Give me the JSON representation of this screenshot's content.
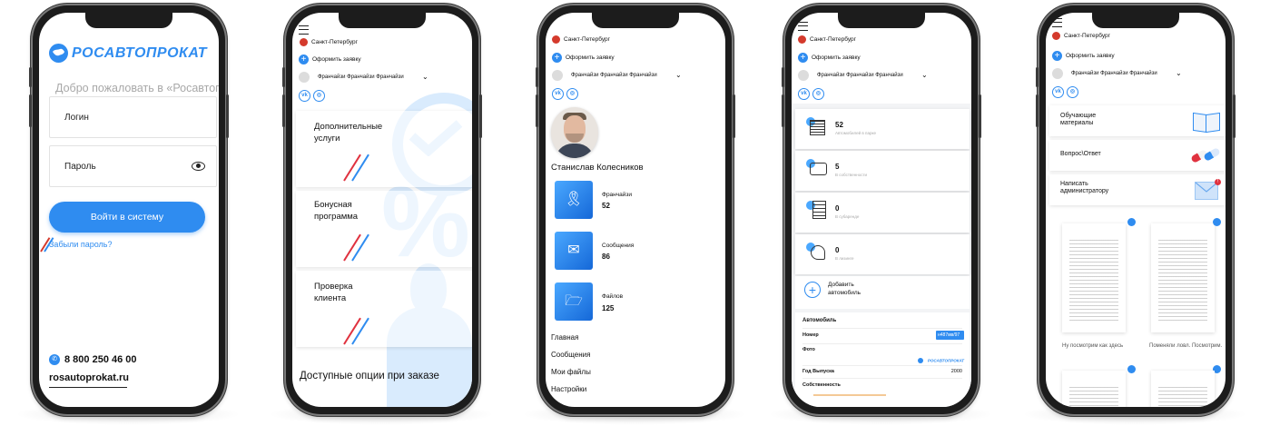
{
  "brand": {
    "logo_text": "РОСАВТОПРОКАТ",
    "accent": "#2f8cf0",
    "city_pin_color": "#d43a2c"
  },
  "login": {
    "welcome": "Добро пожаловать в «Росавтопрок",
    "login_placeholder": "Логин",
    "password_placeholder": "Пароль",
    "submit": "Войти в систему",
    "forgot": "Забыли пароль?",
    "phone": "8 800 250 46 00",
    "site": "rosautoprokat.ru"
  },
  "header": {
    "city": "Санкт-Петербург",
    "order": "Оформить заявку",
    "user": "Франчайзи Франчайзи Франчайзи"
  },
  "options": {
    "items": [
      {
        "label_1": "Дополнительные",
        "label_2": "услуги"
      },
      {
        "label_1": "Бонусная",
        "label_2": "программа"
      },
      {
        "label_1": "Проверка",
        "label_2": "клиента"
      }
    ],
    "footer": "Доступные опции при заказе"
  },
  "profile": {
    "name": "Станислав Колесников",
    "stats": [
      {
        "label": "Франчайзи",
        "value": "52",
        "icon": "medal-icon"
      },
      {
        "label": "Сообщения",
        "value": "86",
        "icon": "envelope-icon"
      },
      {
        "label": "Файлов",
        "value": "125",
        "icon": "folder-icon"
      }
    ],
    "menu": [
      "Главная",
      "Сообщения",
      "Мои файлы",
      "Настройки"
    ]
  },
  "cars": {
    "stats": [
      {
        "value": "52",
        "label": "Автомобилей в парке"
      },
      {
        "value": "5",
        "label": "В собственности"
      },
      {
        "value": "0",
        "label": "В субаренде"
      },
      {
        "value": "0",
        "label": "В лизинге"
      }
    ],
    "add": {
      "label_1": "Добавить",
      "label_2": "автомобиль"
    },
    "table": {
      "title": "Автомобиль",
      "rows": [
        {
          "key": "Номер",
          "value": "н487мв/97"
        },
        {
          "key": "Фото",
          "value": "РОСАВТОПРОКАТ"
        },
        {
          "key": "Год Выпуска",
          "value": "2000"
        },
        {
          "key": "Собственность",
          "value": ""
        }
      ]
    }
  },
  "help": {
    "items": [
      {
        "label_1": "Обучающие",
        "label_2": "материалы",
        "icon": "book-icon"
      },
      {
        "label_1": "Вопрос\\Ответ",
        "label_2": "",
        "icon": "pills-icon"
      },
      {
        "label_1": "Написать",
        "label_2": "администратору",
        "icon": "mail-icon"
      }
    ],
    "docs": [
      {
        "caption": "Ну посмотрим как здесь"
      },
      {
        "caption": "Поменяли ловл. Посмотрим."
      }
    ]
  }
}
